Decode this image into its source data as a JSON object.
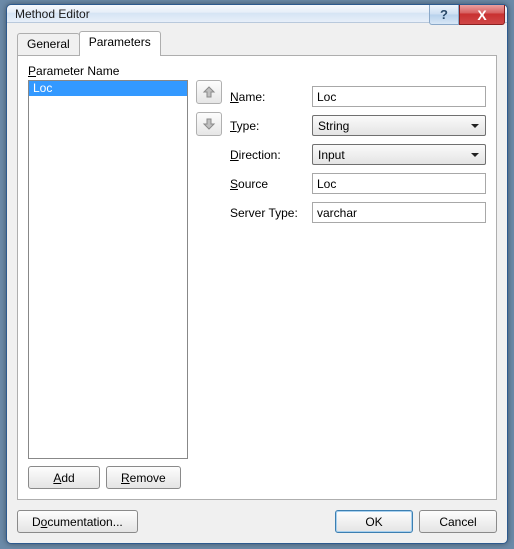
{
  "window": {
    "title": "Method Editor",
    "help_glyph": "?",
    "close_glyph": "X"
  },
  "tabs": {
    "general": "General",
    "parameters": "Parameters"
  },
  "params_panel": {
    "list_label": "Parameter Name",
    "items": [
      "Loc"
    ],
    "add_label": "Add",
    "remove_label": "Remove"
  },
  "details": {
    "name_label": "Name:",
    "name_value": "Loc",
    "type_label": "Type:",
    "type_value": "String",
    "direction_label": "Direction:",
    "direction_value": "Input",
    "source_label": "Source",
    "source_value": "Loc",
    "server_type_label": "Server Type:",
    "server_type_value": "varchar"
  },
  "footer": {
    "documentation": "Documentation...",
    "ok": "OK",
    "cancel": "Cancel"
  }
}
